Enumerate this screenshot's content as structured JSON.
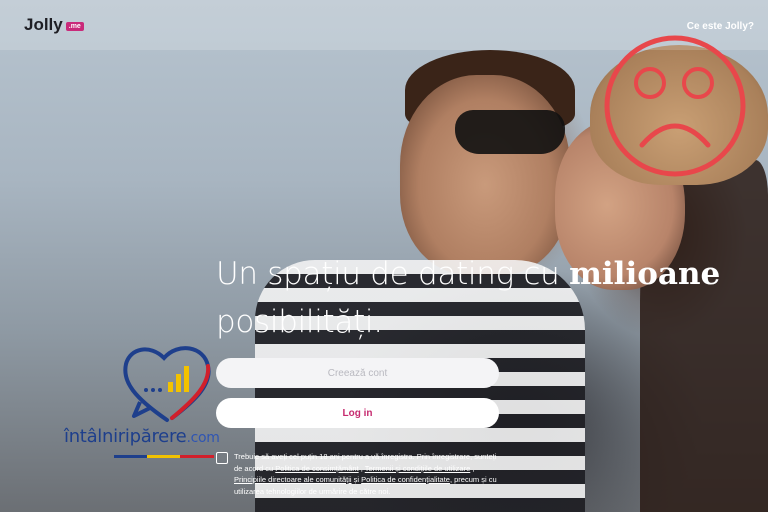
{
  "header": {
    "logo_text": "Jolly",
    "logo_badge": ".me",
    "nav_link": "Ce este Jolly?"
  },
  "hero": {
    "headline_part1": "Un spațiu de dating cu ",
    "headline_bold": "milioane",
    "headline_part2": "posibilități."
  },
  "buttons": {
    "create_account": "Creează cont",
    "login": "Log in"
  },
  "consent": {
    "text1": "Trebuie să aveți cel puțin 18 ani pentru a vă înregistra. Prin înregistrare, sunteți de acord cu ",
    "link_consent": "Politica de consimțământ",
    "sep1": " , ",
    "link_terms": "Termenii și condițiile de utilizare",
    "sep2": " , ",
    "link_guidelines": "Principiile directoare ale comunității",
    "sep3": " și ",
    "link_privacy": "Politica de confidențialitate",
    "text2": ", precum și cu utilizarea tehnologiilor de urmărire de către noi."
  },
  "watermark": {
    "site": "întâlniripărere",
    "tld": ".com"
  },
  "colors": {
    "brand_pink": "#c62a6f",
    "sad_face_red": "#e8474b",
    "watermark_blue": "#1e3f8c"
  }
}
